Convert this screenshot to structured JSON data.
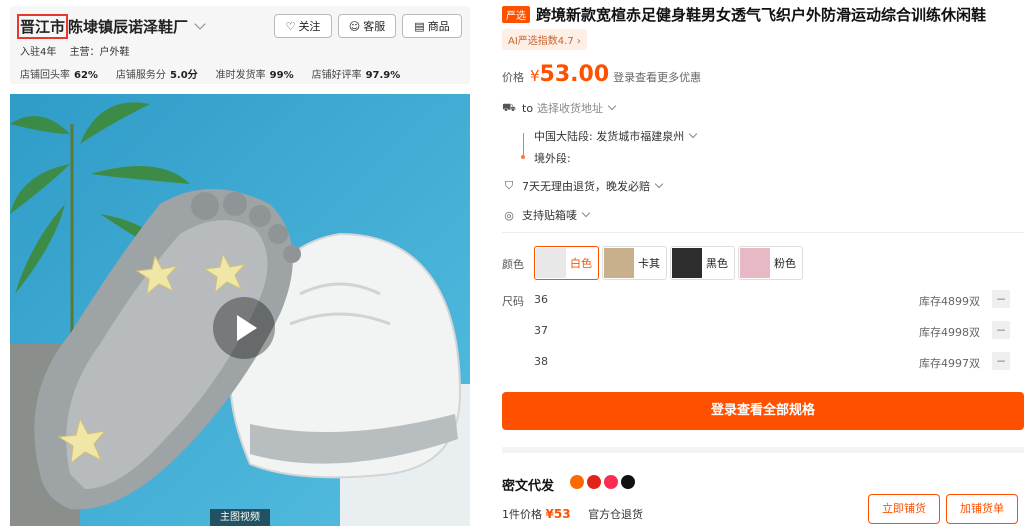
{
  "shop": {
    "city": "晋江市",
    "name_rest": "陈埭镇辰诺泽鞋厂",
    "follow_label": "关注",
    "service_label": "客服",
    "goods_label": "商品",
    "years": "入驻4年",
    "main_business": "主营：户外鞋",
    "stats": [
      {
        "label": "店铺回头率",
        "value": "62%"
      },
      {
        "label": "店铺服务分",
        "value": "5.0分"
      },
      {
        "label": "准时发货率",
        "value": "99%"
      },
      {
        "label": "店铺好评率",
        "value": "97.9%"
      }
    ]
  },
  "media": {
    "video_label": "主图视频"
  },
  "product": {
    "badge": "严选",
    "title": "跨境新款宽楦赤足健身鞋男女透气飞织户外防滑运动综合训练休闲鞋",
    "ai_index": "AI严选指数4.7 ›",
    "price_label": "价格",
    "price_symbol": "¥",
    "price_value": "53.00",
    "price_note": "登录查看更多优惠"
  },
  "shipping": {
    "to": "to",
    "address_placeholder": "选择收货地址",
    "domestic": "中国大陆段: 发货城市福建泉州",
    "overseas": "境外段:"
  },
  "services": {
    "returns": "7天无理由退货，晚发必赔",
    "labeling": "支持贴箱唛"
  },
  "colors": {
    "label": "颜色",
    "options": [
      {
        "name": "白色",
        "thumb": "#e8e8e8"
      },
      {
        "name": "卡其",
        "thumb": "#c9b08c"
      },
      {
        "name": "黑色",
        "thumb": "#2d2d2d"
      },
      {
        "name": "粉色",
        "thumb": "#e7b9c4"
      }
    ]
  },
  "sizes": {
    "label": "尺码",
    "rows": [
      {
        "size": "36",
        "stock": "库存4899双"
      },
      {
        "size": "37",
        "stock": "库存4998双"
      },
      {
        "size": "38",
        "stock": "库存4997双"
      }
    ],
    "minus": "−"
  },
  "cta_label": "登录查看全部规格",
  "dropship": {
    "title": "密文代发",
    "logo_colors": [
      "#ff6a00",
      "#e2231a",
      "#fe2c55",
      "#111111"
    ],
    "unit_label": "1件价格",
    "unit_price": "¥53",
    "return_note": "官方仓退货",
    "btn_list": "立即铺货",
    "btn_add": "加铺货单"
  },
  "colors_theme": {
    "accent": "#ff5000",
    "highlight_box": "#e8372c"
  }
}
